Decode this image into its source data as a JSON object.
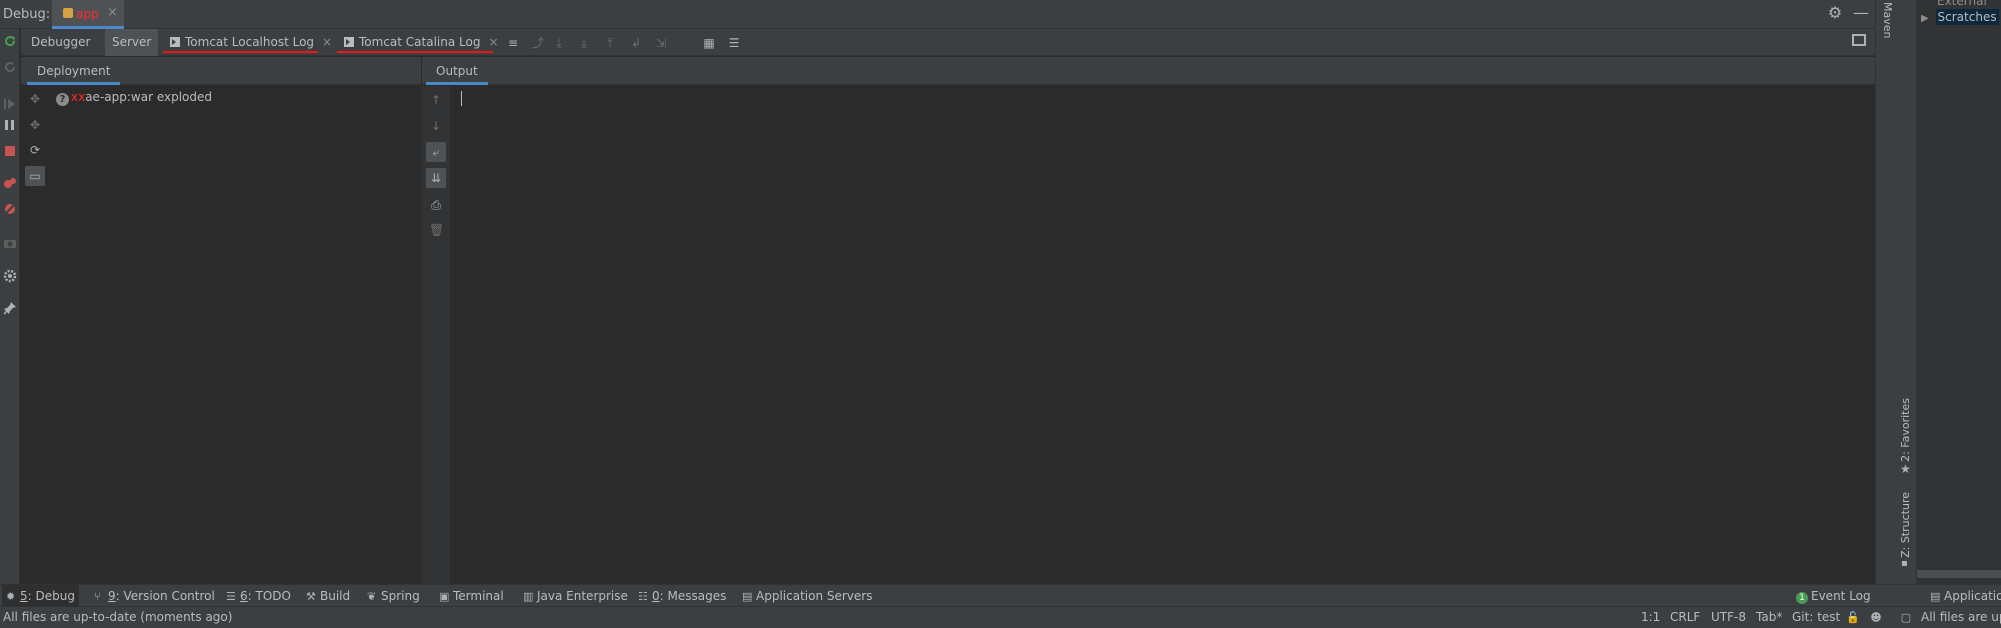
{
  "title_bar": {
    "debug_label": "Debug:",
    "run_config_name": "app",
    "close_symbol": "×"
  },
  "tabs": [
    {
      "label": "Debugger",
      "active": false
    },
    {
      "label": "Server",
      "active": true
    },
    {
      "label": "Tomcat Localhost Log",
      "closable": true
    },
    {
      "label": "Tomcat Catalina Log",
      "closable": true
    }
  ],
  "tab_close_symbol": "×",
  "deployment": {
    "header": "Deployment",
    "item_status": "?",
    "item_redacted": "xx",
    "item_label": "ae-app:war exploded"
  },
  "output": {
    "header": "Output",
    "text": ""
  },
  "right_stripe": {
    "maven": "Maven",
    "favorites": "2: Favorites",
    "structure": "Z: Structure"
  },
  "project_peek": {
    "external_line": "External",
    "scratches": "Scratches"
  },
  "tool_windows": [
    {
      "key": "5",
      "label": ": Debug",
      "icon": "bug-icon",
      "active": true
    },
    {
      "key": "9",
      "label": ": Version Control",
      "icon": "vcs-icon"
    },
    {
      "key": "6",
      "label": ": TODO",
      "icon": "todo-icon"
    },
    {
      "key": "",
      "label": "Build",
      "icon": "hammer-icon"
    },
    {
      "key": "",
      "label": "Spring",
      "icon": "leaf-icon"
    },
    {
      "key": "",
      "label": "Terminal",
      "icon": "terminal-icon"
    },
    {
      "key": "",
      "label": "Java Enterprise",
      "icon": "enterprise-icon"
    },
    {
      "key": "0",
      "label": ": Messages",
      "icon": "messages-icon"
    },
    {
      "key": "",
      "label": "Application Servers",
      "icon": "server-icon"
    }
  ],
  "event_log": {
    "badge": "1",
    "label": "Event Log"
  },
  "applications_peek": "Applications",
  "status_bar": {
    "message": "All files are up-to-date (moments ago)",
    "position": "1:1",
    "line_separator": "CRLF",
    "encoding": "UTF-8",
    "indent": "Tab*",
    "git_branch": "Git: test",
    "right_peek": "All files are up-to-date"
  },
  "colors": {
    "accent_blue": "#4a88c7",
    "annotation_red": "#e8181b",
    "background": "#2b2b2b",
    "panel": "#3c3f41",
    "stop_red": "#c75450",
    "resume_green": "#499c54"
  }
}
